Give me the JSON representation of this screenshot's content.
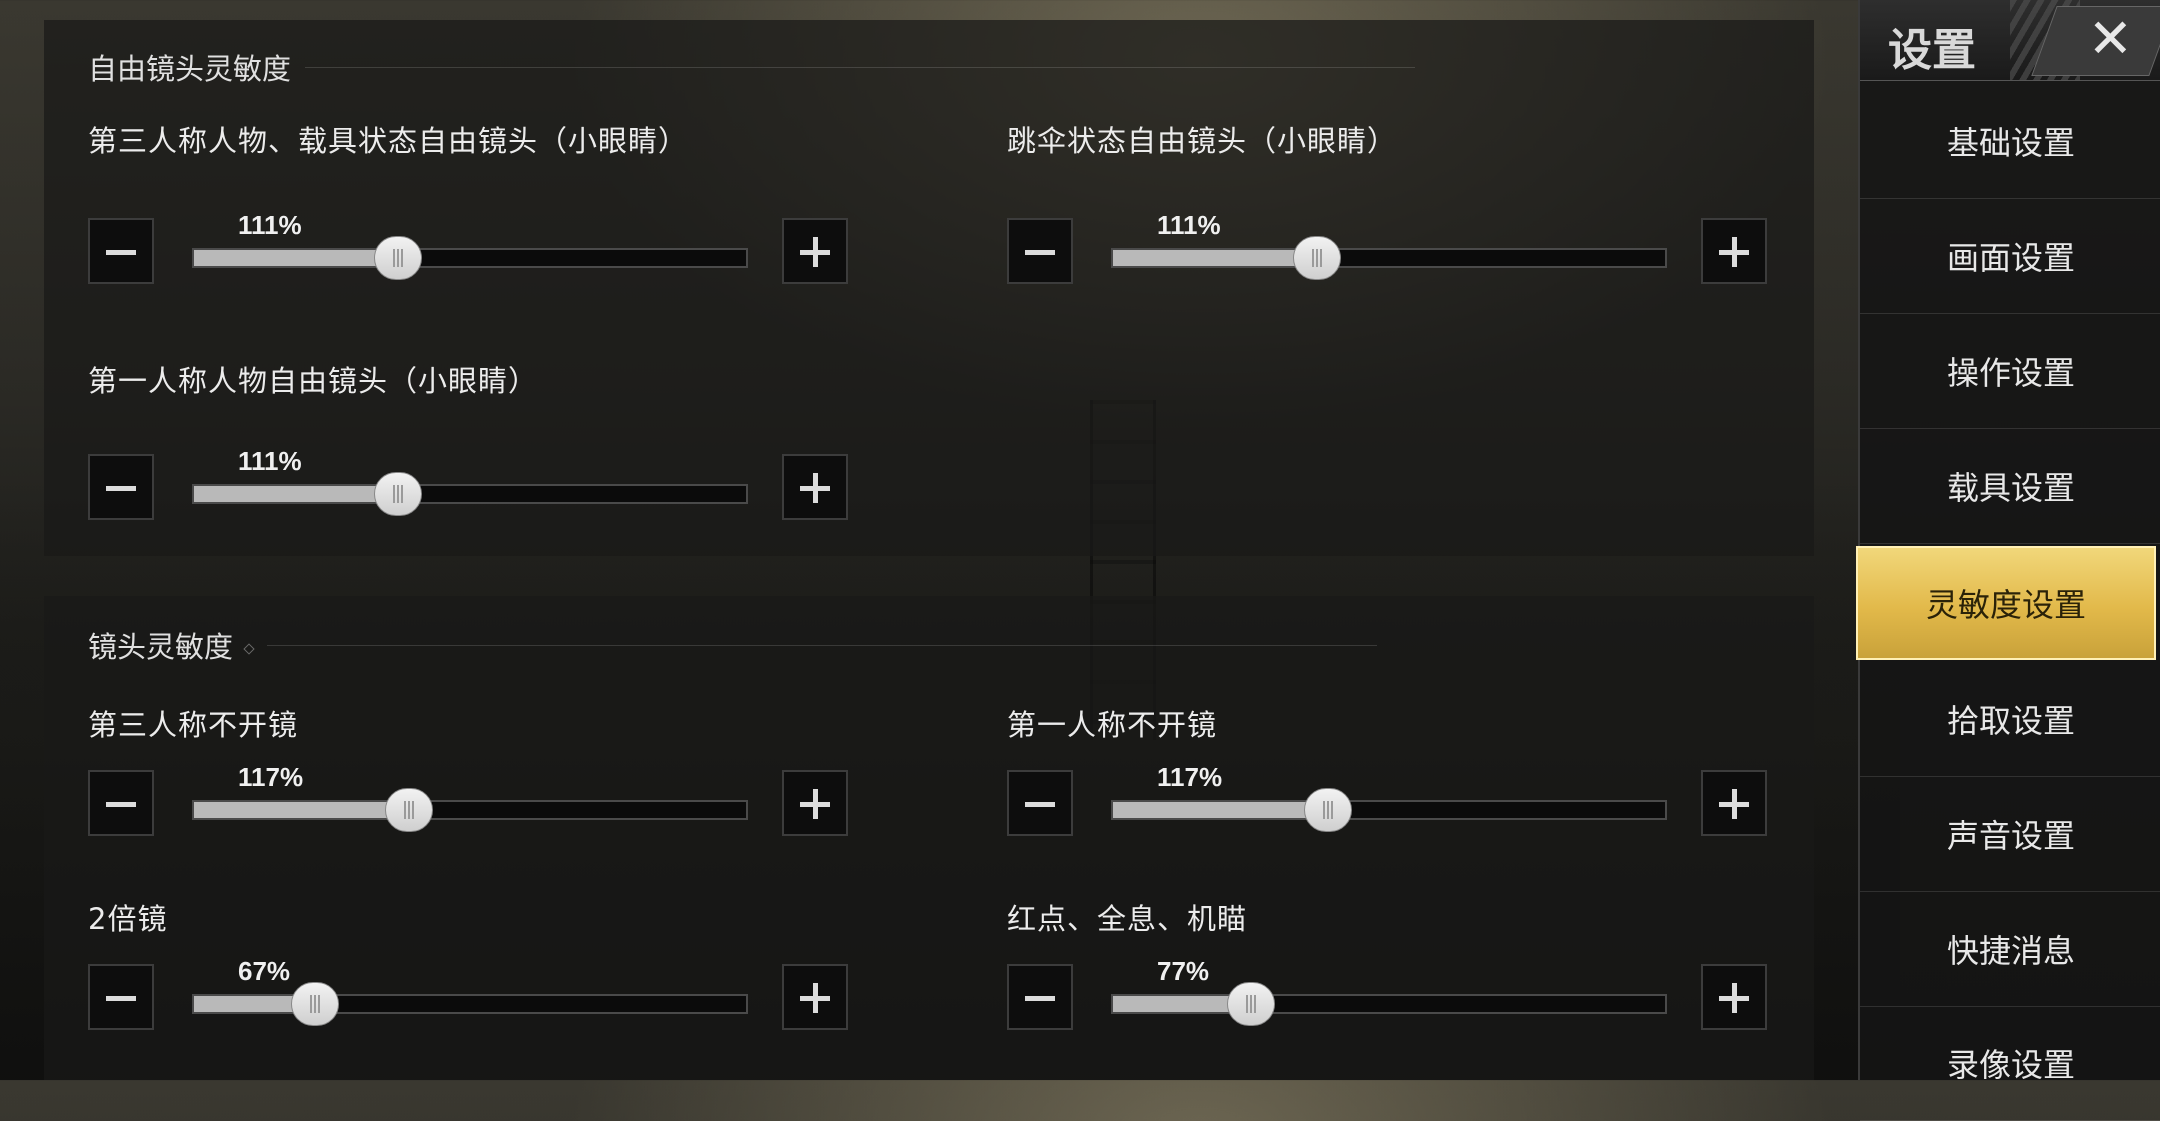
{
  "panels": {
    "free_look": {
      "title": "自由镜头灵敏度",
      "sliders": [
        {
          "label": "第三人称人物、载具状态自由镜头（小眼睛）",
          "value": "111%",
          "fraction": 0.37
        },
        {
          "label": "跳伞状态自由镜头（小眼睛）",
          "value": "111%",
          "fraction": 0.37
        },
        {
          "label": "第一人称人物自由镜头（小眼睛）",
          "value": "111%",
          "fraction": 0.37
        }
      ]
    },
    "camera": {
      "title": "镜头灵敏度",
      "sliders": [
        {
          "label": "第三人称不开镜",
          "value": "117%",
          "fraction": 0.39
        },
        {
          "label": "第一人称不开镜",
          "value": "117%",
          "fraction": 0.39
        },
        {
          "label": "2倍镜",
          "value": "67%",
          "fraction": 0.22
        },
        {
          "label": "红点、全息、机瞄",
          "value": "77%",
          "fraction": 0.25
        }
      ]
    }
  },
  "sidebar": {
    "title": "设置",
    "close_glyph": "✕",
    "items": [
      {
        "label": "基础设置"
      },
      {
        "label": "画面设置"
      },
      {
        "label": "操作设置"
      },
      {
        "label": "载具设置"
      },
      {
        "label": "灵敏度设置",
        "active": true
      },
      {
        "label": "拾取设置"
      },
      {
        "label": "声音设置"
      },
      {
        "label": "快捷消息"
      },
      {
        "label": "录像设置"
      }
    ]
  },
  "colors": {
    "accent_gold": "#e2b94a",
    "slider_fill": "#b9b9b9",
    "panel_bg": "#191917"
  }
}
